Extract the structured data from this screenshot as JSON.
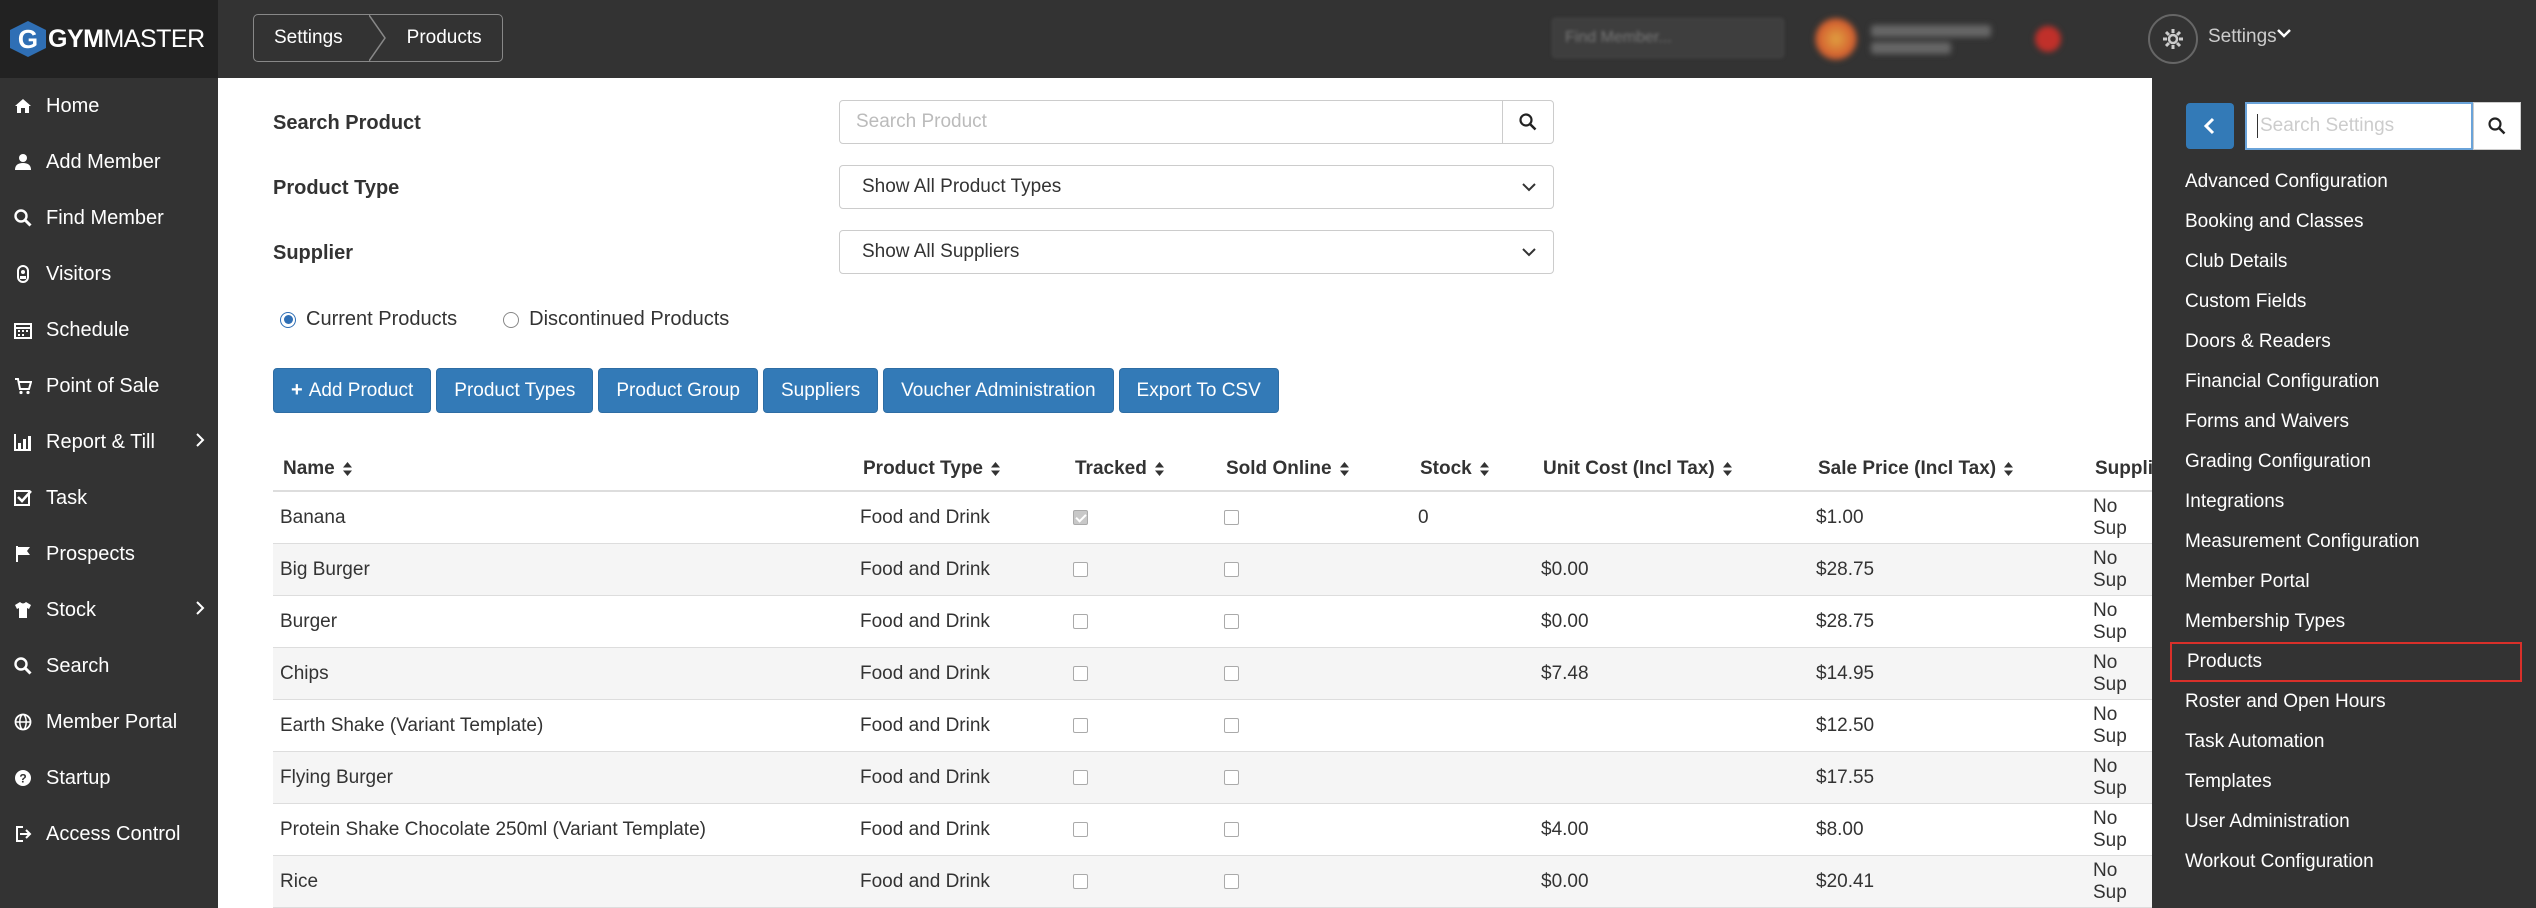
{
  "brand": {
    "logo_letter": "G",
    "logo_bold": "GYM",
    "logo_rest": "MASTER"
  },
  "sidebar": {
    "items": [
      {
        "label": "Home",
        "icon": "home-icon",
        "has_children": false
      },
      {
        "label": "Add Member",
        "icon": "user-icon",
        "has_children": false
      },
      {
        "label": "Find Member",
        "icon": "search-icon",
        "has_children": false
      },
      {
        "label": "Visitors",
        "icon": "visitor-icon",
        "has_children": false
      },
      {
        "label": "Schedule",
        "icon": "calendar-icon",
        "has_children": false
      },
      {
        "label": "Point of Sale",
        "icon": "cart-icon",
        "has_children": false
      },
      {
        "label": "Report & Till",
        "icon": "chart-icon",
        "has_children": true
      },
      {
        "label": "Task",
        "icon": "checkbox-icon",
        "has_children": false
      },
      {
        "label": "Prospects",
        "icon": "flag-icon",
        "has_children": false
      },
      {
        "label": "Stock",
        "icon": "shirt-icon",
        "has_children": true
      },
      {
        "label": "Search",
        "icon": "search-icon",
        "has_children": false
      },
      {
        "label": "Member Portal",
        "icon": "globe-icon",
        "has_children": false
      },
      {
        "label": "Startup",
        "icon": "question-icon",
        "has_children": false
      },
      {
        "label": "Access Control",
        "icon": "signin-icon",
        "has_children": false
      }
    ]
  },
  "header": {
    "breadcrumb": [
      "Settings",
      "Products"
    ],
    "find_member_placeholder": "Find Member...",
    "settings_label": "Settings"
  },
  "filters": {
    "search_label": "Search Product",
    "search_placeholder": "Search Product",
    "type_label": "Product Type",
    "type_value": "Show All Product Types",
    "supplier_label": "Supplier",
    "supplier_value": "Show All Suppliers",
    "radio_current": "Current Products",
    "radio_discontinued": "Discontinued Products"
  },
  "actions": {
    "add_product": "Add Product",
    "product_types": "Product Types",
    "product_group": "Product Group",
    "suppliers": "Suppliers",
    "voucher_admin": "Voucher Administration",
    "export_csv": "Export To CSV"
  },
  "table": {
    "columns": [
      "Name",
      "Product Type",
      "Tracked",
      "Sold Online",
      "Stock",
      "Unit Cost (Incl Tax)",
      "Sale Price (Incl Tax)",
      "Supplie"
    ],
    "rows": [
      {
        "name": "Banana",
        "type": "Food and Drink",
        "tracked": true,
        "online": false,
        "stock": "0",
        "cost": "",
        "price": "$1.00",
        "supplier": "No Sup"
      },
      {
        "name": "Big Burger",
        "type": "Food and Drink",
        "tracked": false,
        "online": false,
        "stock": "",
        "cost": "$0.00",
        "price": "$28.75",
        "supplier": "No Sup"
      },
      {
        "name": "Burger",
        "type": "Food and Drink",
        "tracked": false,
        "online": false,
        "stock": "",
        "cost": "$0.00",
        "price": "$28.75",
        "supplier": "No Sup"
      },
      {
        "name": "Chips",
        "type": "Food and Drink",
        "tracked": false,
        "online": false,
        "stock": "",
        "cost": "$7.48",
        "price": "$14.95",
        "supplier": "No Sup"
      },
      {
        "name": "Earth Shake (Variant Template)",
        "type": "Food and Drink",
        "tracked": false,
        "online": false,
        "stock": "",
        "cost": "",
        "price": "$12.50",
        "supplier": "No Sup"
      },
      {
        "name": "Flying Burger",
        "type": "Food and Drink",
        "tracked": false,
        "online": false,
        "stock": "",
        "cost": "",
        "price": "$17.55",
        "supplier": "No Sup"
      },
      {
        "name": "Protein Shake Chocolate 250ml (Variant Template)",
        "type": "Food and Drink",
        "tracked": false,
        "online": false,
        "stock": "",
        "cost": "$4.00",
        "price": "$8.00",
        "supplier": "No Sup"
      },
      {
        "name": "Rice",
        "type": "Food and Drink",
        "tracked": false,
        "online": false,
        "stock": "",
        "cost": "$0.00",
        "price": "$20.41",
        "supplier": "No Sup"
      }
    ]
  },
  "settings_panel": {
    "search_placeholder": "Search Settings",
    "items": [
      "Advanced Configuration",
      "Booking and Classes",
      "Club Details",
      "Custom Fields",
      "Doors & Readers",
      "Financial Configuration",
      "Forms and Waivers",
      "Grading Configuration",
      "Integrations",
      "Measurement Configuration",
      "Member Portal",
      "Membership Types",
      "Products",
      "Roster and Open Hours",
      "Task Automation",
      "Templates",
      "User Administration",
      "Workout Configuration"
    ],
    "active_index": 12
  },
  "colors": {
    "primary": "#337ab7",
    "dark": "#333333",
    "highlight": "#d9302a"
  }
}
